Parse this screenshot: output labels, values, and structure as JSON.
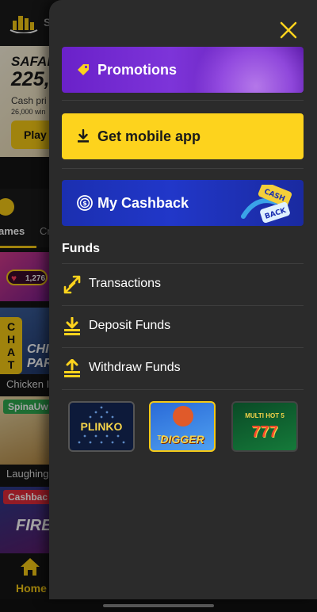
{
  "background": {
    "logo_text": "S",
    "banner": {
      "title": "SAFAR",
      "amount": "225,",
      "subtitle": "Cash pri",
      "subtitle2": "26,000 win",
      "play_label": "Play"
    },
    "tabs": {
      "games_label": "ames",
      "second_label": "Cr"
    },
    "cards": [
      {
        "badge": "",
        "pill_value": "1,276",
        "caption": ""
      },
      {
        "badge": "",
        "title": "CHIC PAR",
        "caption": "Chicken I"
      },
      {
        "badge": "SpinaUw",
        "caption": "Laughing"
      },
      {
        "badge": "Cashbac",
        "title": "FIRE",
        "caption": ""
      }
    ],
    "chat_label": "CHAT",
    "bottom_nav": {
      "home_label": "Home"
    }
  },
  "drawer": {
    "close_icon": "close-icon",
    "promotions": {
      "label": "Promotions",
      "icon": "tag-icon"
    },
    "get_app": {
      "label": "Get mobile app",
      "icon": "download-icon"
    },
    "cashback": {
      "label": "My Cashback",
      "icon": "cashback-icon",
      "deco_text": "CASH BACK"
    },
    "funds": {
      "title": "Funds",
      "items": [
        {
          "label": "Transactions",
          "icon": "transfer-arrows-icon"
        },
        {
          "label": "Deposit Funds",
          "icon": "deposit-icon"
        },
        {
          "label": "Withdraw Funds",
          "icon": "withdraw-icon"
        }
      ]
    },
    "games": [
      {
        "title": "PLINKO"
      },
      {
        "title": "DIGGER",
        "subtitle": "TO"
      },
      {
        "title": "MULTI HOT 5",
        "subtitle": "777"
      }
    ]
  },
  "colors": {
    "accent": "#fdd31d",
    "drawer_bg": "#2b2b2b",
    "promo_purple": "#6a21c9",
    "cashback_blue": "#1b2fb0"
  }
}
